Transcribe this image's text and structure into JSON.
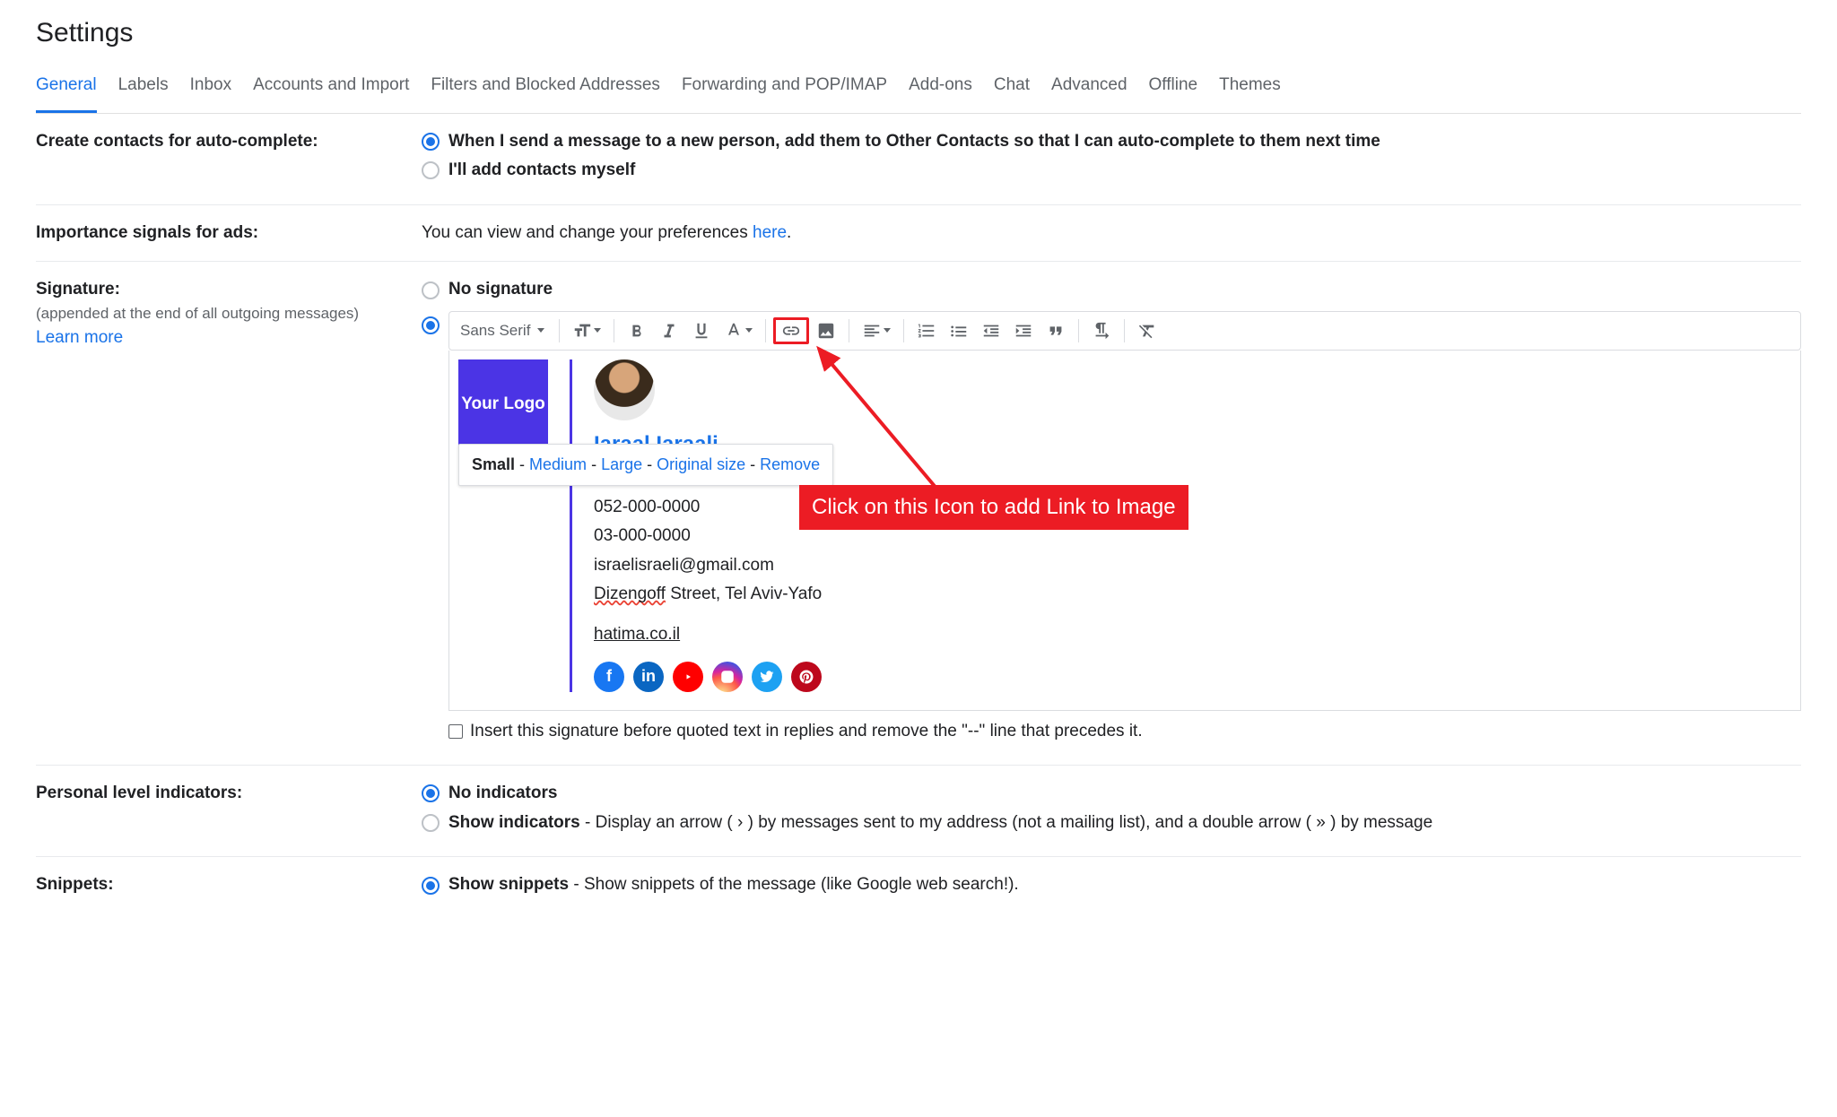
{
  "pageTitle": "Settings",
  "tabs": [
    "General",
    "Labels",
    "Inbox",
    "Accounts and Import",
    "Filters and Blocked Addresses",
    "Forwarding and POP/IMAP",
    "Add-ons",
    "Chat",
    "Advanced",
    "Offline",
    "Themes"
  ],
  "activeTab": 0,
  "autoContacts": {
    "label": "Create contacts for auto-complete:",
    "opt1": "When I send a message to a new person, add them to Other Contacts so that I can auto-complete to them next time",
    "opt2": "I'll add contacts myself"
  },
  "ads": {
    "label": "Importance signals for ads:",
    "textBefore": "You can view and change your preferences ",
    "link": "here",
    "textAfter": "."
  },
  "signature": {
    "label": "Signature:",
    "sub": "(appended at the end of all outgoing messages)",
    "learnMore": "Learn more",
    "opt1": "No signature",
    "fontName": "Sans Serif",
    "logoText": "Your Logo",
    "truncatedName": "Iaraal Iaraali",
    "sizePopup": {
      "small": "Small",
      "sep": " - ",
      "medium": "Medium",
      "large": "Large",
      "original": "Original size",
      "remove": "Remove"
    },
    "phone1": "052-000-0000",
    "phone2": "03-000-0000",
    "email": "israelisraeli@gmail.com",
    "addressSpell": "Dizengoff",
    "addressRest": " Street, Tel Aviv-Yafo",
    "website": "hatima.co.il",
    "callout": "Click on this Icon to add Link to Image",
    "insertBefore": "Insert this signature before quoted text in replies and remove the \"--\" line that precedes it."
  },
  "indicators": {
    "label": "Personal level indicators:",
    "opt1": "No indicators",
    "opt2a": "Show indicators",
    "opt2b": " - Display an arrow ( › ) by messages sent to my address (not a mailing list), and a double arrow ( » ) by message"
  },
  "snippets": {
    "label": "Snippets:",
    "opt1a": "Show snippets",
    "opt1b": " - Show snippets of the message (like Google web search!)."
  }
}
